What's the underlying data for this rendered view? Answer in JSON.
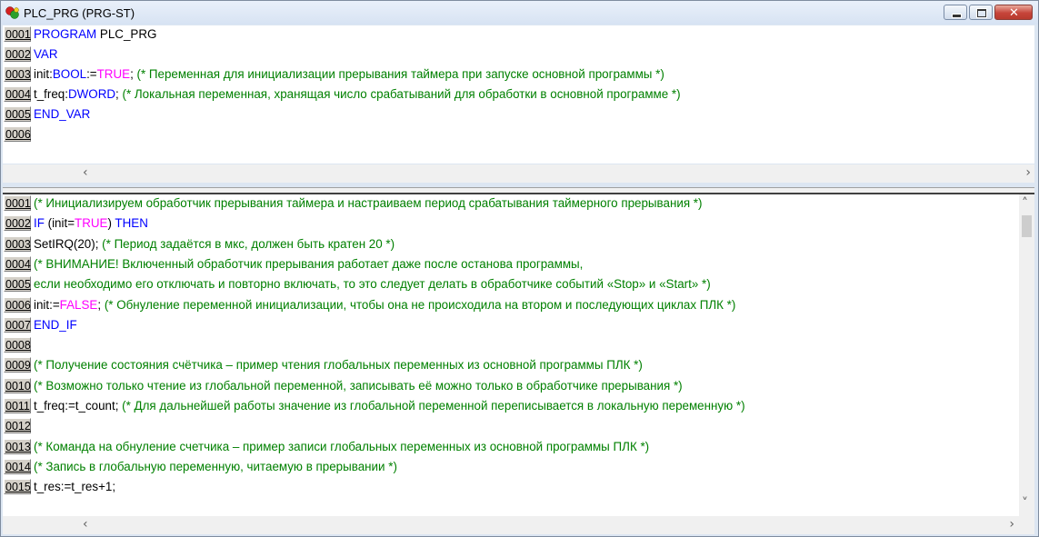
{
  "window": {
    "title": "PLC_PRG (PRG-ST)"
  },
  "declaration": {
    "lines": [
      {
        "num": "0001",
        "parts": [
          {
            "c": "kw",
            "t": "PROGRAM"
          },
          {
            "c": "tx",
            "t": " PLC_PRG"
          }
        ]
      },
      {
        "num": "0002",
        "parts": [
          {
            "c": "kw",
            "t": "VAR"
          }
        ]
      },
      {
        "num": "0003",
        "parts": [
          {
            "c": "tx",
            "t": "      init:"
          },
          {
            "c": "kw",
            "t": "BOOL"
          },
          {
            "c": "tx",
            "t": ":="
          },
          {
            "c": "lit",
            "t": "TRUE"
          },
          {
            "c": "tx",
            "t": "; "
          },
          {
            "c": "cm",
            "t": "(* Переменная для инициализации прерывания таймера при запуске основной программы *)"
          }
        ]
      },
      {
        "num": "0004",
        "parts": [
          {
            "c": "tx",
            "t": "      t_freq:"
          },
          {
            "c": "kw",
            "t": "DWORD"
          },
          {
            "c": "tx",
            "t": "; "
          },
          {
            "c": "cm",
            "t": "(* Локальная переменная, хранящая число срабатываний для обработки в основной программе *)"
          }
        ]
      },
      {
        "num": "0005",
        "parts": [
          {
            "c": "kw",
            "t": "END_VAR"
          }
        ]
      },
      {
        "num": "0006",
        "parts": []
      }
    ]
  },
  "body": {
    "lines": [
      {
        "num": "0001",
        "parts": [
          {
            "c": "cm",
            "t": "(* Инициализируем обработчик прерывания таймера и настраиваем период срабатывания таймерного прерывания *)"
          }
        ]
      },
      {
        "num": "0002",
        "parts": [
          {
            "c": "kw",
            "t": "IF"
          },
          {
            "c": "tx",
            "t": " (init="
          },
          {
            "c": "lit",
            "t": "TRUE"
          },
          {
            "c": "tx",
            "t": ") "
          },
          {
            "c": "kw",
            "t": "THEN"
          }
        ]
      },
      {
        "num": "0003",
        "parts": [
          {
            "c": "tx",
            "t": "      SetIRQ(20); "
          },
          {
            "c": "cm",
            "t": "(* Период задаётся в мкс, должен быть кратен 20 *)"
          }
        ]
      },
      {
        "num": "0004",
        "parts": [
          {
            "c": "cm",
            "t": "      (* ВНИМАНИЕ! Включенный обработчик прерывания работает даже после останова программы,"
          }
        ]
      },
      {
        "num": "0005",
        "parts": [
          {
            "c": "cm",
            "t": "      если необходимо его отключать и повторно включать, то это следует делать в обработчике событий «Stop» и «Start» *)"
          }
        ]
      },
      {
        "num": "0006",
        "parts": [
          {
            "c": "tx",
            "t": "      init:="
          },
          {
            "c": "lit",
            "t": "FALSE"
          },
          {
            "c": "tx",
            "t": "; "
          },
          {
            "c": "cm",
            "t": "(* Обнуление переменной инициализации, чтобы она не происходила на втором и последующих циклах ПЛК *)"
          }
        ]
      },
      {
        "num": "0007",
        "parts": [
          {
            "c": "kw",
            "t": "END_IF"
          }
        ]
      },
      {
        "num": "0008",
        "parts": []
      },
      {
        "num": "0009",
        "parts": [
          {
            "c": "cm",
            "t": "(* Получение состояния счётчика – пример чтения глобальных переменных из основной программы ПЛК *)"
          }
        ]
      },
      {
        "num": "0010",
        "parts": [
          {
            "c": "cm",
            "t": "(* Возможно только чтение из глобальной переменной, записывать её можно только в обработчике прерывания *)"
          }
        ]
      },
      {
        "num": "0011",
        "parts": [
          {
            "c": "tx",
            "t": "t_freq:=t_count; "
          },
          {
            "c": "cm",
            "t": "(* Для дальнейшей работы значение из глобальной переменной переписывается в локальную переменную *)"
          }
        ]
      },
      {
        "num": "0012",
        "parts": []
      },
      {
        "num": "0013",
        "parts": [
          {
            "c": "cm",
            "t": "(* Команда на обнуление счетчика – пример записи глобальных переменных из основной программы ПЛК *)"
          }
        ]
      },
      {
        "num": "0014",
        "parts": [
          {
            "c": "cm",
            "t": "(* Запись в глобальную переменную, читаемую в прерывании *)"
          }
        ]
      },
      {
        "num": "0015",
        "parts": [
          {
            "c": "tx",
            "t": "t_res:=t_res+1;"
          }
        ]
      }
    ]
  },
  "icons": {
    "app": "plc-program-icon",
    "minimize": "minimize-icon",
    "maximize": "maximize-icon",
    "close": "close-icon"
  }
}
